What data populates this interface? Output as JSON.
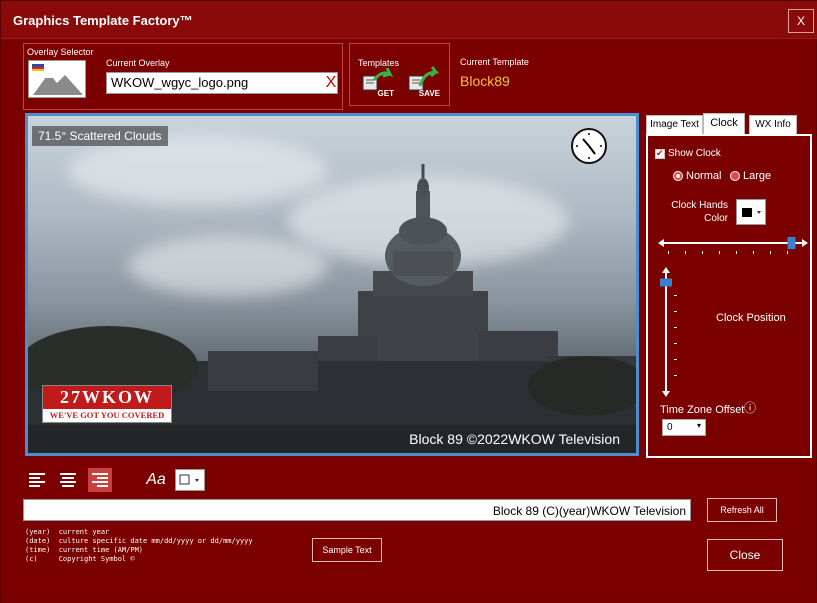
{
  "window": {
    "title": "Graphics Template Factory™",
    "close_label": "X"
  },
  "overlay": {
    "group_label": "Overlay Selector",
    "current_label": "Current Overlay",
    "current_value": "WKOW_wgyc_logo.png",
    "clear_label": "X"
  },
  "templates": {
    "group_label": "Templates",
    "get_label": "GET",
    "save_label": "SAVE",
    "current_label": "Current Template",
    "current_value": "Block89"
  },
  "preview": {
    "weather_text": "71.5° Scattered Clouds",
    "logo_top": "27WKOW",
    "logo_bottom": "WE'VE GOT YOU COVERED",
    "bottom_text": "Block 89 ©2022WKOW Television"
  },
  "tabs": [
    "Image Text",
    "Clock",
    "WX Info"
  ],
  "clock_panel": {
    "show_clock_label": "Show Clock",
    "show_clock_checked": true,
    "size_options": [
      "Normal",
      "Large"
    ],
    "size_selected": "Normal",
    "hands_color_label": "Clock Hands Color",
    "hands_color": "#000000",
    "position_label": "Clock Position",
    "tz_label": "Time Zone Offset",
    "tz_value": "0",
    "horizontal_level": 0.95,
    "vertical_level": 0.05
  },
  "text_tools": {
    "align_selected": "right",
    "font_icon_label": "Aa"
  },
  "text_line": {
    "value": "Block 89 (C)(year)WKOW Television"
  },
  "buttons": {
    "refresh_all": "Refresh All",
    "sample_text": "Sample Text",
    "close": "Close"
  },
  "help_lines": [
    "(year)  current year",
    "(date)  culture specific date mm/dd/yyyy or dd/mm/yyyy",
    "(time)  current time (AM/PM)",
    "(c)     Copyright Symbol ©"
  ],
  "colors": {
    "background": "#7b0000",
    "accent_border": "#c84040",
    "template_value": "#f3c33a",
    "preview_border": "#4b8fd0",
    "slider_thumb": "#3a7fd0"
  },
  "icons": [
    "preview-icon",
    "get-template-icon",
    "save-template-icon",
    "align-left-icon",
    "align-center-icon",
    "align-right-icon",
    "font-icon",
    "color-picker-icon",
    "info-icon"
  ]
}
